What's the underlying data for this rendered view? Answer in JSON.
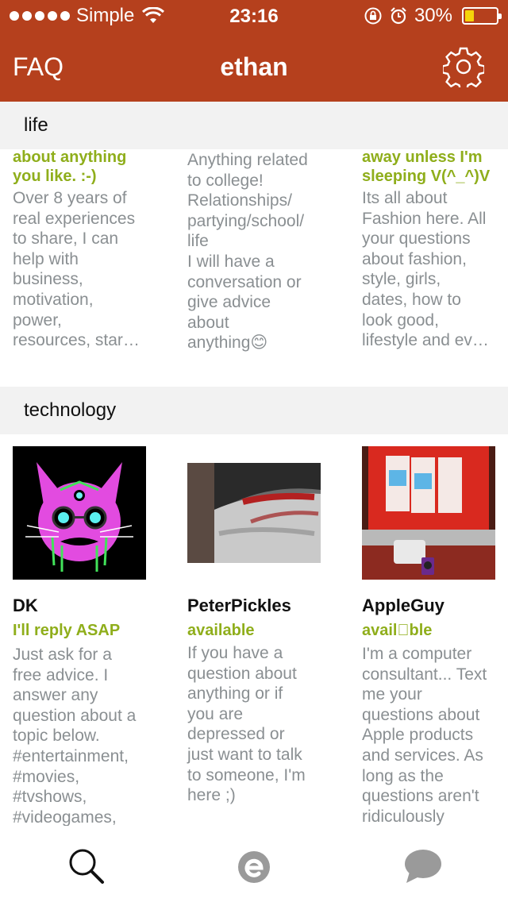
{
  "status_bar": {
    "carrier": "Simple",
    "time": "23:16",
    "battery_percent": "30%",
    "battery_level": 0.3
  },
  "nav": {
    "left_label": "FAQ",
    "title": "ethan"
  },
  "sections": [
    {
      "title": "life",
      "cards": [
        {
          "status": "about anything\nyou like. :-)",
          "description": "Over 8 years of\nreal experiences\nto share, I can\nhelp with\nbusiness,\nmotivation,\npower,\nresources, star…"
        },
        {
          "status": "",
          "description": "Anything related\nto college!\nRelationships/\npartying/school/\nlife\nI will have a\nconversation or\ngive advice\nabout\nanything😊"
        },
        {
          "status": "away unless I'm\nsleeping V(^_^)V",
          "description": "Its all about\nFashion here. All\nyour questions\nabout fashion,\nstyle, girls,\ndates, how to\nlook good,\nlifestyle and ev…"
        }
      ]
    },
    {
      "title": "technology",
      "cards": [
        {
          "name": "DK",
          "status": "I'll reply ASAP",
          "description": "Just ask for a\nfree advice. I\nanswer any\nquestion about a\ntopic below.\n#entertainment,\n#movies,\n#tvshows,\n#videogames,"
        },
        {
          "name": "PeterPickles",
          "status": "available",
          "description": "If you have a\nquestion about\nanything or if\nyou are\ndepressed or\njust want to talk\nto someone, I'm\nhere ;)"
        },
        {
          "name": "AppleGuy",
          "status": "availble",
          "description": "I'm a computer\nconsultant... Text\nme your\nquestions about\nApple products\nand services. As\nlong as the\nquestions aren't\nridiculously"
        }
      ]
    }
  ],
  "colors": {
    "accent": "#b5401d",
    "status_green": "#8fae1b",
    "description_gray": "#8a8f92",
    "tab_active": "#111111",
    "tab_inactive": "#9a9a9a"
  },
  "tabs": [
    {
      "icon": "search-icon",
      "active": true
    },
    {
      "icon": "ethan-e-icon",
      "active": false
    },
    {
      "icon": "chat-bubble-icon",
      "active": false
    }
  ]
}
